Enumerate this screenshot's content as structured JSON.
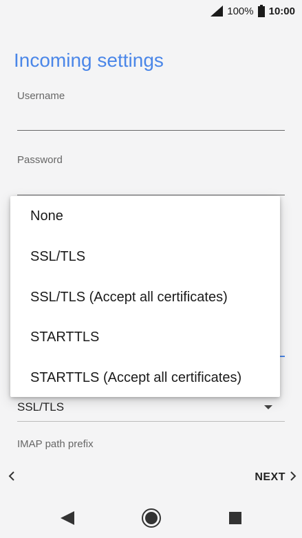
{
  "status_bar": {
    "battery_percent": "100%",
    "time": "10:00",
    "icons": [
      "signal-icon",
      "battery-icon"
    ]
  },
  "page": {
    "title": "Incoming settings",
    "fields": {
      "username": {
        "label": "Username",
        "value": ""
      },
      "password": {
        "label": "Password",
        "value": ""
      }
    },
    "security_type": {
      "selected": "SSL/TLS"
    },
    "imap_path_prefix": {
      "label": "IMAP path prefix"
    }
  },
  "wizard_nav": {
    "next_label": "NEXT",
    "icons": [
      "chevron-left-icon",
      "chevron-right-icon"
    ]
  },
  "security_menu": {
    "options": [
      "None",
      "SSL/TLS",
      "SSL/TLS (Accept all certificates)",
      "STARTTLS",
      "STARTTLS (Accept all certificates)"
    ]
  },
  "nav_bar": {
    "icons": [
      "back-triangle-icon",
      "home-circle-icon",
      "recents-square-icon"
    ]
  },
  "colors": {
    "accent": "#4a86e8",
    "background": "#f4f4f5",
    "menu_background": "#ffffff"
  }
}
